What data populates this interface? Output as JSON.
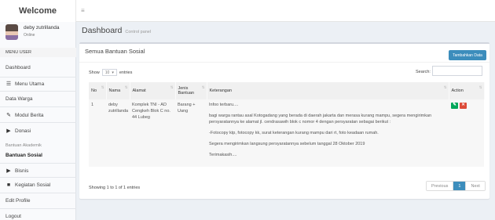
{
  "brand": "Welcome",
  "toggle_icon": "sidebar-toggle-icon",
  "user": {
    "name": "deby zutrillanda",
    "status": "Online"
  },
  "sidebar": {
    "header": "MENU USER",
    "items": [
      {
        "label": "Dashboard",
        "icon": ""
      },
      {
        "label": "Menu Utama",
        "icon": "list-icon"
      },
      {
        "label": "Data Warga",
        "icon": ""
      },
      {
        "label": "Modul Berita",
        "icon": "pencil-icon"
      },
      {
        "label": "Donasi",
        "icon": "caret-right-icon"
      },
      {
        "label": "Bantuan Akademik",
        "icon": ""
      },
      {
        "label": "Bantuan Sosial",
        "icon": ""
      },
      {
        "label": "Bisnis",
        "icon": "caret-right-icon"
      },
      {
        "label": "Kegiatan Sosial",
        "icon": "book-icon"
      },
      {
        "label": "Edit Profile",
        "icon": ""
      },
      {
        "label": "Logout",
        "icon": ""
      }
    ]
  },
  "page": {
    "title": "Dashboard",
    "subtitle": "Control panel"
  },
  "box": {
    "title": "Semua Bantuan Sosial",
    "add_button": "Tambahkan Data",
    "show_label": "Show",
    "show_value": "10",
    "entries_label": "entries",
    "search_label": "Search:",
    "search_value": ""
  },
  "table": {
    "headers": [
      "No",
      "Nama",
      "Alamat",
      "Jenis Bantuan",
      "Keterangan",
      "Action"
    ],
    "rows": [
      {
        "no": "1",
        "nama": "deby zutrillanda",
        "alamat": "Komplek TNI - AD Cengkeh Blok C no. 44 Lubeg",
        "jenis": "Barang + Uang",
        "keterangan": [
          "Infoo terbaru....",
          "bagi warga rantau asal Kotogadang yang berada di daerah jakarta dan merasa kurang mampu, segera mengirimkan persyaratannya ke alamat jl. cendrasawih blok c nomor 4 dengan persyaratan sebagai berikut :",
          "-Fotocopy ktp, fotocopy kk, surat keterangan kurang mampu dari rt, foto keadaan rumah.",
          "Segera mengirimkan langsung persyaratannya sebelum tanggal 28 Oktober 2019",
          "Terimakasih...."
        ]
      }
    ]
  },
  "footer": {
    "info": "Showing 1 to 1 of 1 entries",
    "prev": "Previous",
    "page": "1",
    "next": "Next"
  },
  "colors": {
    "primary": "#3c8dbc",
    "success": "#00a65a",
    "danger": "#dd4b39"
  }
}
